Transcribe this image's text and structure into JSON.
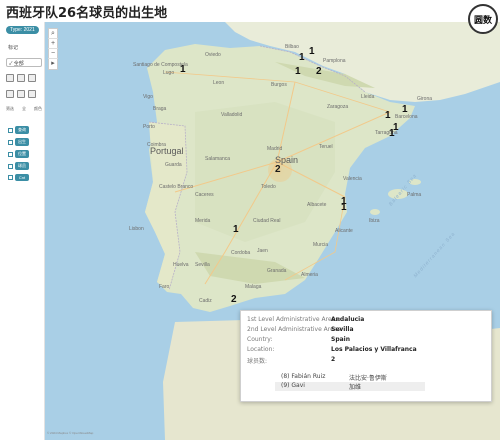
{
  "header": {
    "title": "西班牙队26名球员的出生地",
    "logo_text": "圆数"
  },
  "panel": {
    "type_filter": "Type: 2021",
    "legend_title": "标记",
    "select_value": "✓ 全部",
    "tool_labels": [
      "筛选",
      "全",
      "颜色"
    ],
    "checkbox_items": [
      "查询",
      "出生",
      "位置",
      "球员",
      "Cnt"
    ]
  },
  "map_controls": [
    "⌕",
    "+",
    "−",
    "▸"
  ],
  "map_labels": {
    "country_portugal": "Portugal",
    "country_spain": "Spain",
    "sea_balearic": "Balearic Sea",
    "sea_mediterranean": "Mediterranean Sea",
    "attribution": "© 2024 Mapbox © OpenStreetMap"
  },
  "cities": [
    "Santiago de Compostela",
    "Lugo",
    "Oviedo",
    "Bilbao",
    "Pamplona",
    "Leon",
    "Burgos",
    "Vigo",
    "Braga",
    "Porto",
    "Valladolid",
    "Zaragoza",
    "Barcelona",
    "Tarragona",
    "Guarda",
    "Salamanca",
    "Madrid",
    "Toledo",
    "Castelo Branco",
    "Caceres",
    "Valencia",
    "Lisbon",
    "Merida",
    "Ciudad Real",
    "Albacete",
    "Alicante",
    "Cordoba",
    "Murcia",
    "Faro",
    "Sevilla",
    "Granada",
    "Almeria",
    "Malaga",
    "Coimbra",
    "Teruel",
    "Lleida",
    "Girona",
    "Palma",
    "Ibiza",
    "Huelva",
    "Cadiz",
    "Jaen"
  ],
  "player_counts": [
    "1",
    "1",
    "1",
    "2",
    "1",
    "1",
    "1",
    "1",
    "1",
    "2",
    "1",
    "1",
    "2",
    "1"
  ],
  "tooltip": {
    "rows": [
      {
        "key": "1st Level Administrative Areas:",
        "value": "Andalucia"
      },
      {
        "key": "2nd Level Administrative Areas:",
        "value": "Sevilla"
      },
      {
        "key": "Country:",
        "value": "Spain"
      },
      {
        "key": "Location:",
        "value": "Los Palacios y Villafranca"
      },
      {
        "key": "球员数:",
        "value": "2"
      }
    ],
    "players": [
      {
        "name": "(8) Fabián Ruiz",
        "cn": "法比安·鲁伊斯"
      },
      {
        "name": "(9) Gavi",
        "cn": "加维"
      }
    ]
  }
}
